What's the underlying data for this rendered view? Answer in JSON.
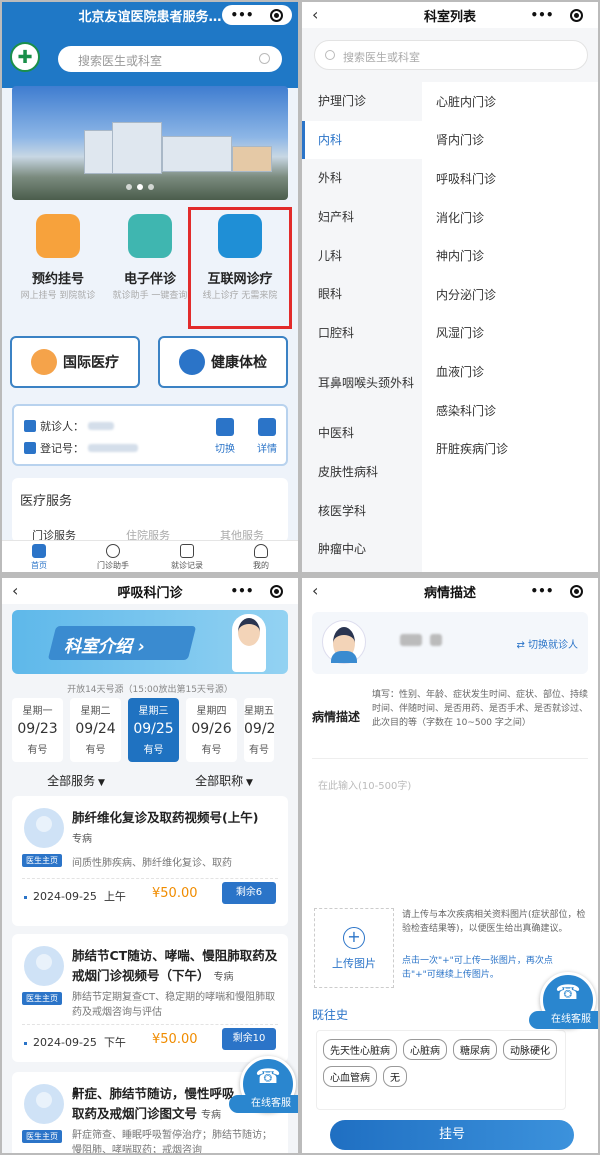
{
  "panel1": {
    "title": "北京友谊医院患者服务…",
    "search_placeholder": "搜索医生或科室",
    "services": [
      {
        "name": "预约挂号",
        "desc": "网上挂号 到院就诊",
        "color": "#f7a23c"
      },
      {
        "name": "电子伴诊",
        "desc": "就诊助手 一键查询",
        "color": "#3fb6b0"
      },
      {
        "name": "互联网诊疗",
        "desc": "线上诊疗 无需来院",
        "color": "#1f8fd6"
      }
    ],
    "big_buttons": [
      {
        "label": "国际医疗"
      },
      {
        "label": "健康体检"
      }
    ],
    "patient": {
      "label_visitor": "就诊人：",
      "label_reg": "登记号：",
      "switch": "切换",
      "detail": "详情"
    },
    "med_services": {
      "heading": "医疗服务",
      "tabs": [
        "门诊服务",
        "住院服务",
        "其他服务"
      ]
    },
    "tabbar": [
      "首页",
      "门诊助手",
      "就诊记录",
      "我的"
    ]
  },
  "panel2": {
    "title": "科室列表",
    "search_placeholder": "搜索医生或科室",
    "left": [
      "护理门诊",
      "内科",
      "外科",
      "妇产科",
      "儿科",
      "眼科",
      "口腔科",
      "耳鼻咽喉头颈外科",
      "中医科",
      "皮肤性病科",
      "核医学科",
      "肿瘤中心"
    ],
    "right": [
      "心脏内门诊",
      "肾内门诊",
      "呼吸科门诊",
      "消化门诊",
      "神内门诊",
      "内分泌门诊",
      "风湿门诊",
      "血液门诊",
      "感染科门诊",
      "肝脏疾病门诊"
    ]
  },
  "panel3": {
    "title": "呼吸科门诊",
    "intro": "科室介绍 ›",
    "note": "开放14天号源（15:00放出第15天号源）",
    "days": [
      {
        "week": "星期一",
        "date": "09/23",
        "status": "有号"
      },
      {
        "week": "星期二",
        "date": "09/24",
        "status": "有号"
      },
      {
        "week": "星期三",
        "date": "09/25",
        "status": "有号"
      },
      {
        "week": "星期四",
        "date": "09/26",
        "status": "有号"
      },
      {
        "week": "星期五",
        "date": "09/27",
        "status": "有号"
      }
    ],
    "filters": [
      "全部服务",
      "全部职称"
    ],
    "home_tag": "医生主页",
    "cards": [
      {
        "name": "肺纤维化复诊及取药视频号(上午)",
        "type": "专病",
        "desc": "间质性肺疾病、肺纤维化复诊、取药",
        "date": "2024-09-25",
        "period": "上午",
        "price": "¥50.00",
        "remain": "剩余6"
      },
      {
        "name": "肺结节CT随访、哮喘、慢阻肺取药及戒烟门诊视频号（下午）",
        "type": "专病",
        "desc": "肺结节定期复查CT、稳定期的哮喘和慢阻肺取药及戒烟咨询与评估",
        "date": "2024-09-25",
        "period": "下午",
        "price": "¥50.00",
        "remain": "剩余10"
      },
      {
        "name": "鼾症、肺结节随访，慢性呼吸取药及戒烟门诊图文号",
        "type": "专病",
        "desc": "鼾症筛查、睡眠呼吸暂停治疗；肺结节随访；慢阻肺、哮喘取药；戒烟咨询"
      }
    ],
    "kefu": "在线客服"
  },
  "panel4": {
    "title": "病情描述",
    "switch": "切换就诊人",
    "desc_label": "病情描述",
    "desc_hint": "填写：性别、年龄、症状发生时间、症状、部位、持续时间、伴随时间、是否用药、是否手术、是否就诊过、此次目的等（字数在 10~500 字之间）",
    "input_placeholder": "在此输入(10-500字)",
    "upload": "上传图片",
    "upload_hint": "请上传与本次疾病相关资料图片(症状部位，检验检查结果等)，以便医生给出真确建议。",
    "upload_hint2": "点击一次\"+\"可上传一张图片，再次点击\"+\"可继续上传图片。",
    "history_label": "既往史",
    "history": [
      "先天性心脏病",
      "心脏病",
      "糖尿病",
      "动脉硬化",
      "心血管病",
      "无"
    ],
    "submit": "挂号",
    "kefu": "在线客服"
  }
}
